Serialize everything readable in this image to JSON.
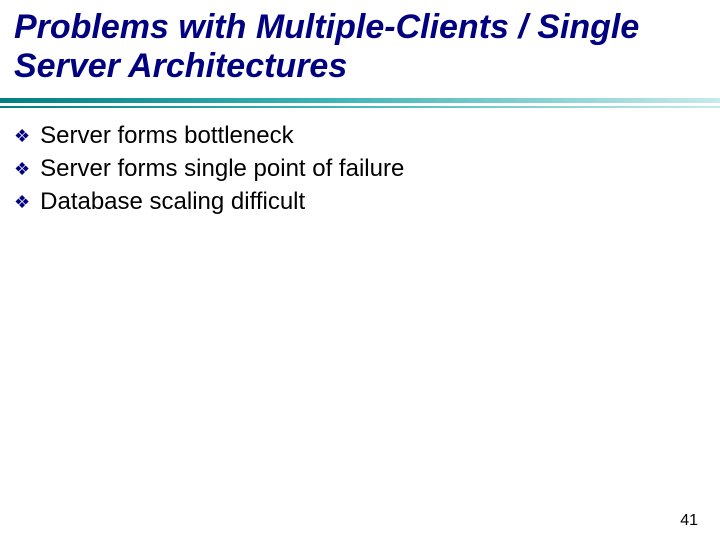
{
  "title": "Problems with Multiple-Clients / Single Server Architectures",
  "bullets": [
    "Server forms bottleneck",
    "Server forms single point of failure",
    "Database scaling difficult"
  ],
  "pageNumber": "41",
  "accentColor": "#000080",
  "dividerGradient": [
    "#008080",
    "#c7eaea"
  ]
}
